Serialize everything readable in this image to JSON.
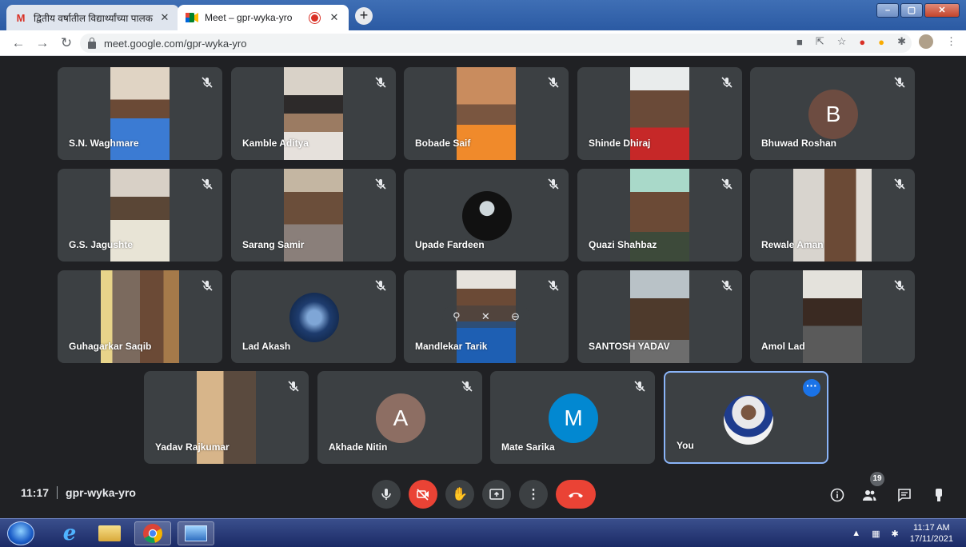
{
  "browser": {
    "tabs": [
      {
        "title": "द्वितीय वर्षातील विद्यार्थ्यांच्या पालक",
        "icon": "gmail-icon",
        "active": false
      },
      {
        "title": "Meet – gpr-wyka-yro",
        "icon": "meet-icon",
        "active": true
      }
    ],
    "url": "meet.google.com/gpr-wyka-yro"
  },
  "participants": [
    {
      "name": "S.N. Waghmare"
    },
    {
      "name": "Kamble Aditya"
    },
    {
      "name": "Bobade Saif"
    },
    {
      "name": "Shinde Dhiraj"
    },
    {
      "name": "Bhuwad Roshan",
      "avatar_letter": "B"
    },
    {
      "name": "G.S. Jagushte"
    },
    {
      "name": "Sarang Samir"
    },
    {
      "name": "Upade Fardeen"
    },
    {
      "name": "Quazi Shahbaz"
    },
    {
      "name": "Rewale Aman"
    },
    {
      "name": "Guhagarkar Saqib"
    },
    {
      "name": "Lad Akash"
    },
    {
      "name": "Mandlekar Tarik"
    },
    {
      "name": "SANTOSH YADAV"
    },
    {
      "name": "Amol Lad"
    },
    {
      "name": "Yadav Rajkumar"
    },
    {
      "name": "Akhade Nitin",
      "avatar_letter": "A"
    },
    {
      "name": "Mate Sarika",
      "avatar_letter": "M"
    },
    {
      "name": "You"
    }
  ],
  "meeting": {
    "time": "11:17",
    "code": "gpr-wyka-yro",
    "people_count": "19"
  },
  "taskbar": {
    "time": "11:17 AM",
    "date": "17/11/2021"
  },
  "colors": {
    "meet_background": "#202124",
    "tile": "#3c4043",
    "hangup": "#ea4335",
    "self_outline": "#8ab4f8",
    "avatar_B": "#6d4c41",
    "avatar_A": "#8d6e63",
    "avatar_M": "#0288d1"
  }
}
